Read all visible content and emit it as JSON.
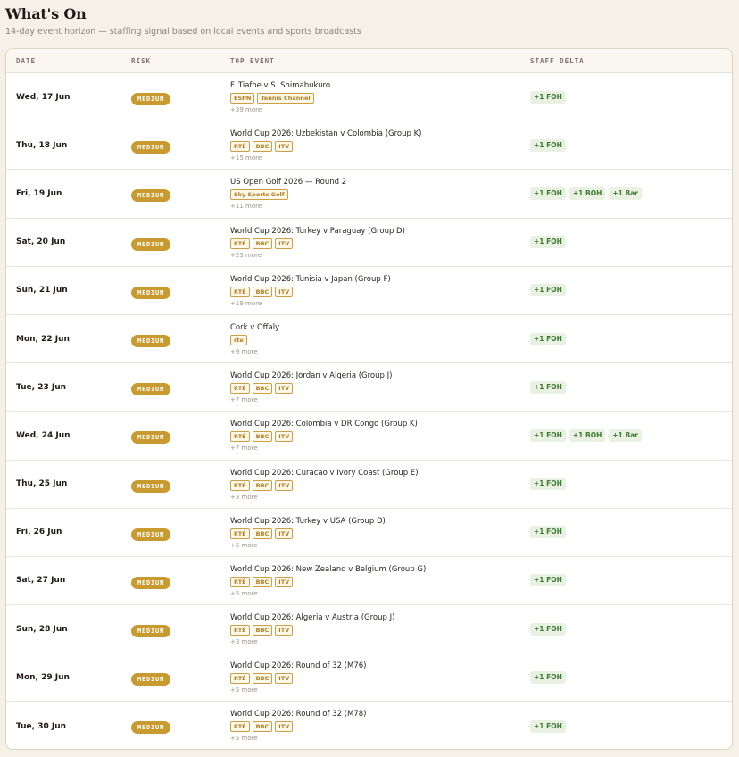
{
  "page": {
    "title": "What's On",
    "subtitle": "14-day event horizon — staffing signal based on local events and sports broadcasts"
  },
  "table": {
    "headers": {
      "date": "DATE",
      "risk": "RISK",
      "event": "TOP EVENT",
      "staff": "STAFF DELTA"
    },
    "rows": [
      {
        "date": "Wed, 17 Jun",
        "risk": "MEDIUM",
        "event": "F. Tiafoe v S. Shimabukuro",
        "tags": [
          "ESPN",
          "Tennis Channel"
        ],
        "more": "+39 more",
        "staff": [
          "+1 FOH"
        ]
      },
      {
        "date": "Thu, 18 Jun",
        "risk": "MEDIUM",
        "event": "World Cup 2026: Uzbekistan v Colombia (Group K)",
        "tags": [
          "RTÉ",
          "BBC",
          "ITV"
        ],
        "more": "+15 more",
        "staff": [
          "+1 FOH"
        ]
      },
      {
        "date": "Fri, 19 Jun",
        "risk": "MEDIUM",
        "event": "US Open Golf 2026 — Round 2",
        "tags": [
          "Sky Sports Golf"
        ],
        "more": "+11 more",
        "staff": [
          "+1 FOH",
          "+1 BOH",
          "+1 Bar"
        ]
      },
      {
        "date": "Sat, 20 Jun",
        "risk": "MEDIUM",
        "event": "World Cup 2026: Turkey v Paraguay (Group D)",
        "tags": [
          "RTÉ",
          "BBC",
          "ITV"
        ],
        "more": "+25 more",
        "staff": [
          "+1 FOH"
        ]
      },
      {
        "date": "Sun, 21 Jun",
        "risk": "MEDIUM",
        "event": "World Cup 2026: Tunisia v Japan (Group F)",
        "tags": [
          "RTÉ",
          "BBC",
          "ITV"
        ],
        "more": "+19 more",
        "staff": [
          "+1 FOH"
        ]
      },
      {
        "date": "Mon, 22 Jun",
        "risk": "MEDIUM",
        "event": "Cork v Offaly",
        "tags": [
          "rte"
        ],
        "more": "+9 more",
        "staff": [
          "+1 FOH"
        ]
      },
      {
        "date": "Tue, 23 Jun",
        "risk": "MEDIUM",
        "event": "World Cup 2026: Jordan v Algeria (Group J)",
        "tags": [
          "RTÉ",
          "BBC",
          "ITV"
        ],
        "more": "+7 more",
        "staff": [
          "+1 FOH"
        ]
      },
      {
        "date": "Wed, 24 Jun",
        "risk": "MEDIUM",
        "event": "World Cup 2026: Colombia v DR Congo (Group K)",
        "tags": [
          "RTÉ",
          "BBC",
          "ITV"
        ],
        "more": "+7 more",
        "staff": [
          "+1 FOH",
          "+1 BOH",
          "+1 Bar"
        ]
      },
      {
        "date": "Thu, 25 Jun",
        "risk": "MEDIUM",
        "event": "World Cup 2026: Curacao v Ivory Coast (Group E)",
        "tags": [
          "RTÉ",
          "BBC",
          "ITV"
        ],
        "more": "+3 more",
        "staff": [
          "+1 FOH"
        ]
      },
      {
        "date": "Fri, 26 Jun",
        "risk": "MEDIUM",
        "event": "World Cup 2026: Turkey v USA (Group D)",
        "tags": [
          "RTÉ",
          "BBC",
          "ITV"
        ],
        "more": "+5 more",
        "staff": [
          "+1 FOH"
        ]
      },
      {
        "date": "Sat, 27 Jun",
        "risk": "MEDIUM",
        "event": "World Cup 2026: New Zealand v Belgium (Group G)",
        "tags": [
          "RTÉ",
          "BBC",
          "ITV"
        ],
        "more": "+5 more",
        "staff": [
          "+1 FOH"
        ]
      },
      {
        "date": "Sun, 28 Jun",
        "risk": "MEDIUM",
        "event": "World Cup 2026: Algeria v Austria (Group J)",
        "tags": [
          "RTÉ",
          "BBC",
          "ITV"
        ],
        "more": "+3 more",
        "staff": [
          "+1 FOH"
        ]
      },
      {
        "date": "Mon, 29 Jun",
        "risk": "MEDIUM",
        "event": "World Cup 2026: Round of 32 (M76)",
        "tags": [
          "RTÉ",
          "BBC",
          "ITV"
        ],
        "more": "+5 more",
        "staff": [
          "+1 FOH"
        ]
      },
      {
        "date": "Tue, 30 Jun",
        "risk": "MEDIUM",
        "event": "World Cup 2026: Round of 32 (M78)",
        "tags": [
          "RTÉ",
          "BBC",
          "ITV"
        ],
        "more": "+5 more",
        "staff": [
          "+1 FOH"
        ]
      }
    ]
  },
  "colors": {
    "background": "#f6f1e7",
    "risk_medium": "#c99a30",
    "tag_border": "#cc9f47",
    "staff_pill_bg": "#e9f1e3",
    "staff_pill_text": "#3d7a32"
  }
}
